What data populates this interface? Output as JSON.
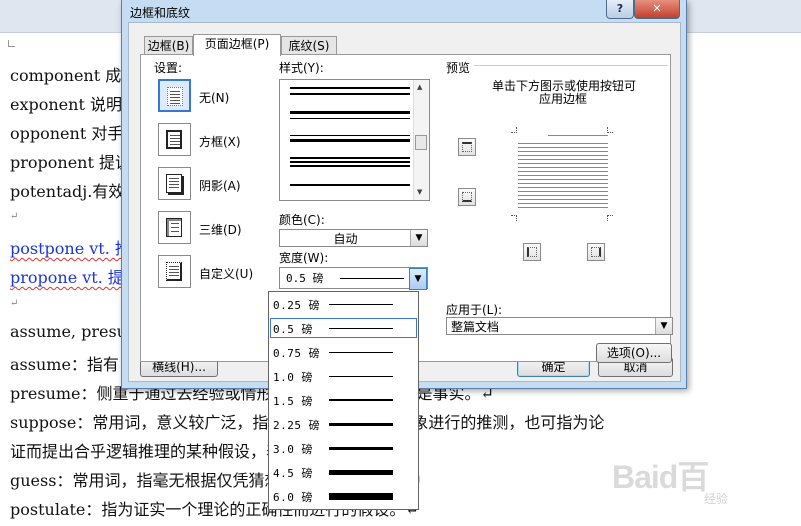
{
  "document": {
    "lines": [
      "component 成",
      "exponent 说明",
      "opponent 对手",
      "proponent 提议",
      "potentadj.有效",
      "↵",
      "postpone vt. 推",
      "propone  vt. 提",
      "↵",
      "assume, presu",
      "assume：指有",
      "presume：侧重于通过去经验或情形推断，把某事认定为是事实。↵",
      "suppose：常用词，意义较广泛，指不确实，根据一些现象进行的推测，也可指为论",
      "证而提出合乎逻辑推理的某种假设，表示自己的意见。↵",
      "guess：常用词，指毫无根据仅凭猜想或碰运气的猜测。↵",
      "postulate：指为证实一个理论的正确性而进行的假设。↵"
    ]
  },
  "dialog": {
    "title": "边框和底纹",
    "help_label": "?",
    "close_label": "✕",
    "tabs": [
      "边框(B)",
      "页面边框(P)",
      "底纹(S)"
    ],
    "settings_label": "设置:",
    "settings": [
      "无(N)",
      "方框(X)",
      "阴影(A)",
      "三维(D)",
      "自定义(U)"
    ],
    "style_label": "样式(Y):",
    "color_label": "颜色(C):",
    "color_value": "自动",
    "width_label": "宽度(W):",
    "width_value": "0.5 磅",
    "preview_label": "预览",
    "preview_hint_1": "单击下方图示或使用按钮可",
    "preview_hint_2": "应用边框",
    "apply_label": "应用于(L):",
    "apply_value": "整篇文档",
    "options_button": "选项(O)...",
    "hline_button": "横线(H)...",
    "ok_button": "确定",
    "cancel_button": "取消"
  },
  "width_options": [
    {
      "label": "0.25 磅",
      "pt": 0.25
    },
    {
      "label": "0.5 磅",
      "pt": 0.5
    },
    {
      "label": "0.75 磅",
      "pt": 0.75
    },
    {
      "label": "1.0 磅",
      "pt": 1.0
    },
    {
      "label": "1.5 磅",
      "pt": 1.5
    },
    {
      "label": "2.25 磅",
      "pt": 2.25
    },
    {
      "label": "3.0 磅",
      "pt": 3.0
    },
    {
      "label": "4.5 磅",
      "pt": 4.5
    },
    {
      "label": "6.0 磅",
      "pt": 6.0
    }
  ],
  "selected_width_index": 1,
  "watermark": {
    "main": "Baid百",
    "sub": "经验"
  },
  "colors": {
    "accent": "#3a78d0",
    "title_bar": "#c6dcf2",
    "link_text": "#1a35d8"
  }
}
